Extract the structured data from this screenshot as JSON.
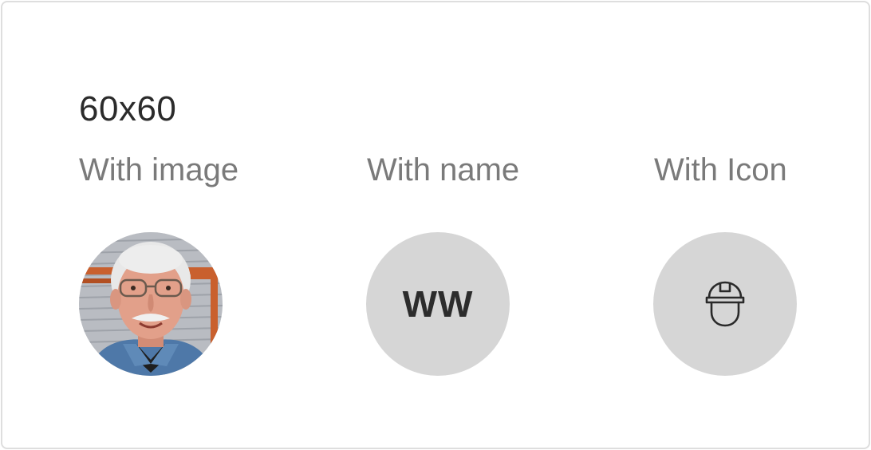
{
  "section_title": "60x60",
  "columns": [
    {
      "label": "With image"
    },
    {
      "label": "With name",
      "initials": "WW"
    },
    {
      "label": "With Icon",
      "icon": "hard-hat-icon"
    }
  ],
  "colors": {
    "avatar_background": "#d6d6d6",
    "label_text": "#7a7a7a",
    "title_text": "#2b2b2b",
    "initials_text": "#2c2c2c",
    "card_border": "#dedede"
  }
}
